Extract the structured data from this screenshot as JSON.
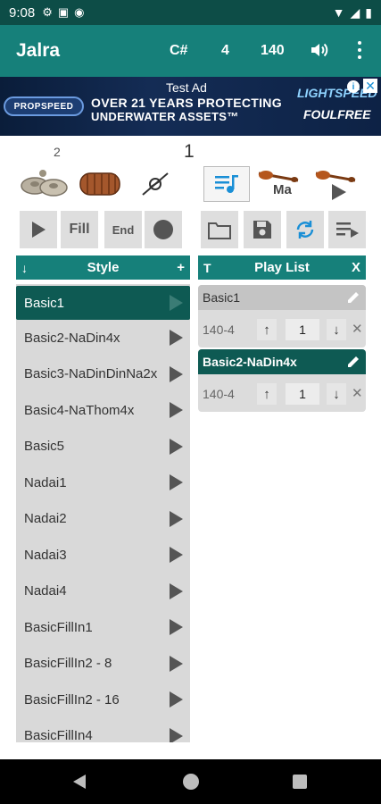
{
  "status": {
    "time": "9:08"
  },
  "appbar": {
    "title": "Jalra",
    "key": "C#",
    "beats": "4",
    "tempo": "140"
  },
  "ad": {
    "label": "Test Ad",
    "line1": "OVER 21 YEARS PROTECTING",
    "line2": "UNDERWATER ASSETS™",
    "brand_left": "PROPSPEED",
    "brand_right_1": "LIGHTSPEED",
    "brand_right_2": "FOULFREE"
  },
  "counters": {
    "left": "2",
    "center": "1"
  },
  "instrument_tiles": {
    "ma_label": "Ma"
  },
  "controls": {
    "fill_label": "Fill",
    "end_label": "End"
  },
  "style_panel": {
    "header": "Style",
    "left_symbol": "↓",
    "right_symbol": "+"
  },
  "playlist_panel": {
    "header": "Play List",
    "left_symbol": "T",
    "right_symbol": "X"
  },
  "styles": [
    "Basic1",
    "Basic2-NaDin4x",
    "Basic3-NaDinDinNa2x",
    "Basic4-NaThom4x",
    "Basic5",
    "Nadai1",
    "Nadai2",
    "Nadai3",
    "Nadai4",
    "BasicFillIn1",
    "BasicFillIn2 - 8",
    "BasicFillIn2 - 16",
    "BasicFillIn4"
  ],
  "playlist": [
    {
      "name": "Basic1",
      "tempo": "140-4",
      "count": "1"
    },
    {
      "name": "Basic2-NaDin4x",
      "tempo": "140-4",
      "count": "1"
    }
  ],
  "colors": {
    "teal": "#16807a",
    "dark_teal": "#0e5a53",
    "status_bar": "#0d4d47"
  }
}
